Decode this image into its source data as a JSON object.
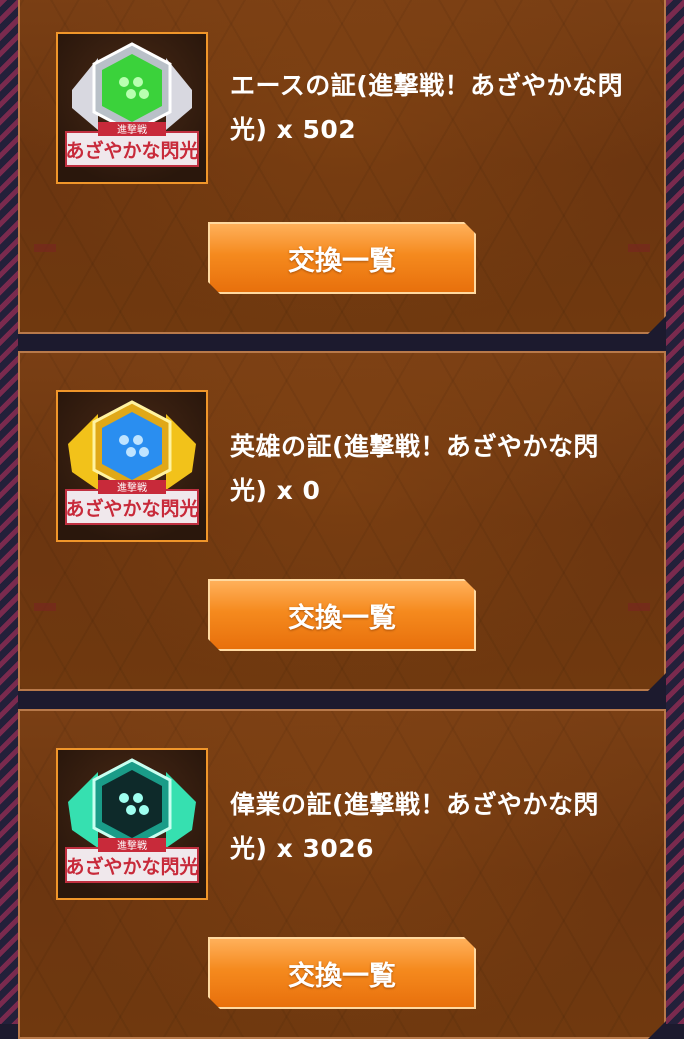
{
  "items": [
    {
      "name": "エースの証(進撃戦！あざやかな閃光) x 502",
      "button_label": "交換一覧",
      "badge_caption": "あざやかな閃光",
      "badge_subtitle": "進撃戦",
      "gem_color": "#3bd23b",
      "wing_color": "#d8d8e0",
      "icon": "ace-medal-icon"
    },
    {
      "name": "英雄の証(進撃戦！あざやかな閃光) x 0",
      "button_label": "交換一覧",
      "badge_caption": "あざやかな閃光",
      "badge_subtitle": "進撃戦",
      "gem_color": "#2a8ef0",
      "wing_color": "#f2c21a",
      "icon": "hero-medal-icon"
    },
    {
      "name": "偉業の証(進撃戦！あざやかな閃光) x 3026",
      "button_label": "交換一覧",
      "badge_caption": "あざやかな閃光",
      "badge_subtitle": "進撃戦",
      "gem_color": "#2fd8c0",
      "wing_color": "#36e0b0",
      "icon": "feat-medal-icon"
    }
  ]
}
